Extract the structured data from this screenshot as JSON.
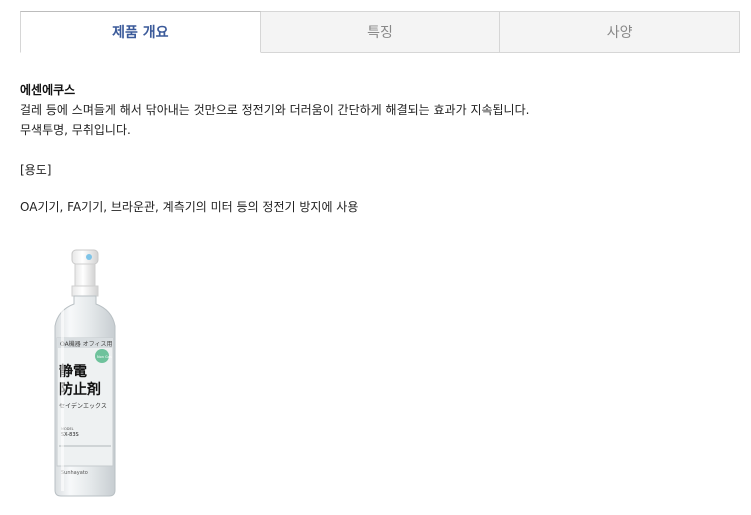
{
  "tabs": [
    {
      "label": "제품 개요",
      "active": true
    },
    {
      "label": "특징",
      "active": false
    },
    {
      "label": "사양",
      "active": false
    }
  ],
  "content": {
    "product_name": "에센에쿠스",
    "description_line1": "걸레 등에 스며들게 해서 닦아내는 것만으로 정전기와 더러움이 간단하게 해결되는 효과가 지속됩니다.",
    "description_line2": "무색투명, 무취입니다.",
    "usage_heading": "[용도]",
    "usage_text": "OA기기, FA기기, 브라운관, 계측기의 미터 등의 정전기 방지에 사용"
  },
  "product_image": {
    "label_top": "OA機器 オフィス用",
    "badge": "Non Gas",
    "title_line1": "静電",
    "title_line2": "防止剤",
    "subtitle": "セイデンエックス",
    "model_label": "MODEL",
    "model": "SX-83S",
    "brand": "Sunhayato"
  },
  "colors": {
    "active_tab_text": "#3b5a9a",
    "inactive_tab_text": "#888888",
    "tab_bg": "#f4f4f4"
  }
}
